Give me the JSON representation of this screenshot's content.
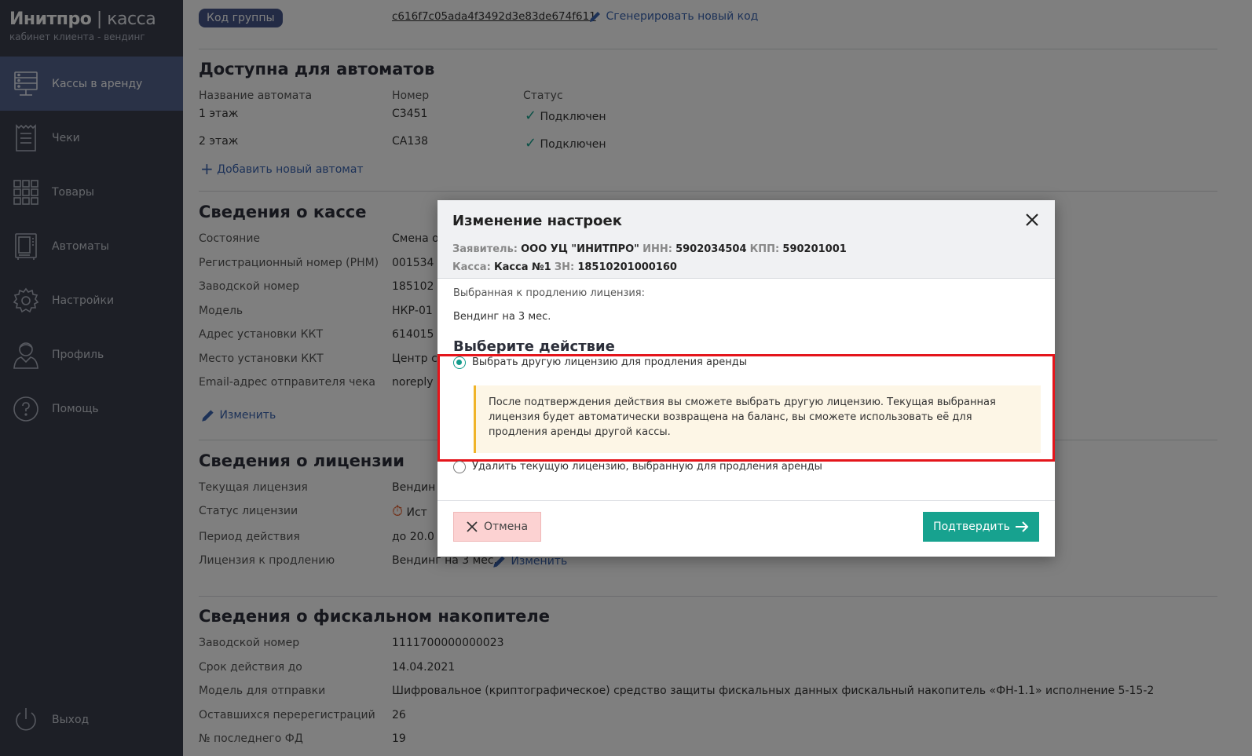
{
  "brand": {
    "title_bold": "Инитпро",
    "title_sep": " | ",
    "title_thin": "касса",
    "subtitle": "кабинет клиента - вендинг"
  },
  "sidebar": {
    "items": [
      {
        "label": "Кассы в аренду",
        "icon": "server-icon",
        "active": true
      },
      {
        "label": "Чеки",
        "icon": "receipt-icon"
      },
      {
        "label": "Товары",
        "icon": "grid-icon"
      },
      {
        "label": "Автоматы",
        "icon": "vending-machine-icon"
      },
      {
        "label": "Настройки",
        "icon": "gear-icon"
      },
      {
        "label": "Профиль",
        "icon": "user-icon"
      },
      {
        "label": "Помощь",
        "icon": "help-icon"
      }
    ],
    "logout": {
      "label": "Выход",
      "icon": "power-icon"
    }
  },
  "group": {
    "badge": "Код группы",
    "code": "c616f7c05ada4f3492d3e83de674f611",
    "generate": "Сгенерировать новый код"
  },
  "machines": {
    "title": "Доступна для автоматов",
    "headers": [
      "Название автомата",
      "Номер",
      "Статус"
    ],
    "rows": [
      {
        "name": "1 этаж",
        "number": "C3451",
        "status": "Подключен"
      },
      {
        "name": "2 этаж",
        "number": "CA138",
        "status": "Подключен"
      }
    ],
    "add": "Добавить новый автомат"
  },
  "kassa": {
    "title": "Сведения о кассе",
    "rows": [
      {
        "label": "Состояние",
        "value": "Смена о"
      },
      {
        "label": "Регистрационный номер (РНМ)",
        "value": "001534"
      },
      {
        "label": "Заводской номер",
        "value": "185102"
      },
      {
        "label": "Модель",
        "value": "НКР-01"
      },
      {
        "label": "Адрес установки ККТ",
        "value": "614015"
      },
      {
        "label": "Место установки ККТ",
        "value": "Центр с"
      },
      {
        "label": "Email-адрес отправителя чека",
        "value": "noreply"
      }
    ],
    "edit": "Изменить"
  },
  "license": {
    "title": "Сведения о лицензии",
    "rows": [
      {
        "label": "Текущая лицензия",
        "value": "Вендин"
      },
      {
        "label": "Статус лицензии",
        "value": "Ист"
      },
      {
        "label": "Период действия",
        "value": "до 20.0"
      },
      {
        "label": "Лицензия к продлению",
        "value": "Вендинг на 3 мес."
      }
    ],
    "edit": "Изменить"
  },
  "fn": {
    "title": "Сведения о фискальном накопителе",
    "rows": [
      {
        "label": "Заводской номер",
        "value": "1111700000000023"
      },
      {
        "label": "Срок действия до",
        "value": "14.04.2021"
      },
      {
        "label": "Модель для отправки",
        "value": "Шифровальное (криптографическое) средство защиты фискальных данных фискальный накопитель «ФН-1.1» исполнение 5-15-2"
      },
      {
        "label": "Оставшихся перерегистраций",
        "value": "26"
      },
      {
        "label": "№ последнего ФД",
        "value": "19"
      }
    ]
  },
  "modal": {
    "title": "Изменение настроек",
    "applicant_k": "Заявитель:",
    "applicant_v": "ООО УЦ \"ИНИТПРО\"",
    "inn_k": "ИНН:",
    "inn_v": "5902034504",
    "kpp_k": "КПП:",
    "kpp_v": "590201001",
    "kassa_k": "Касса:",
    "kassa_v": "Касса №1",
    "zn_k": "ЗН:",
    "zn_v": "18510201000160",
    "selected_label": "Выбранная к продлению лицензия:",
    "selected_value": "Вендинг на 3 мес.",
    "choose": "Выберите действие",
    "option1": "Выбрать другую лицензию для продления аренды",
    "notice": "После подтверждения действия вы сможете выбрать другую лицензию. Текущая выбранная лицензия будет автоматически возвращена на баланс, вы сможете использовать её для продления аренды другой кассы.",
    "option2": "Удалить текущую лицензию, выбранную для продления аренды",
    "cancel": "Отмена",
    "confirm": "Подтвердить"
  }
}
